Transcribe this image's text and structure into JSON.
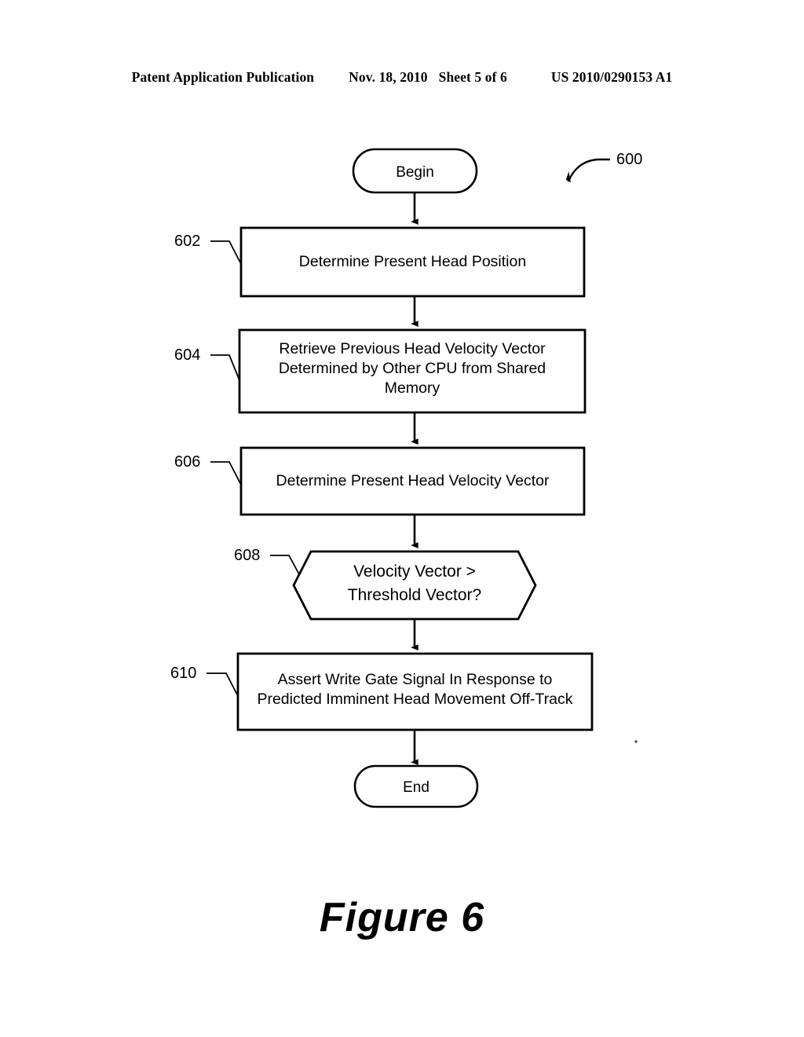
{
  "header": {
    "publication": "Patent Application Publication",
    "date": "Nov. 18, 2010",
    "sheet": "Sheet 5 of 6",
    "patent_number": "US 2010/0290153 A1"
  },
  "figure": {
    "caption": "Figure 6",
    "diagram_reference": "600",
    "nodes": [
      {
        "id": "begin",
        "shape": "terminal",
        "label": "Begin",
        "ref": null
      },
      {
        "id": "step-602",
        "shape": "process",
        "label": "Determine Present Head Position",
        "ref": "602"
      },
      {
        "id": "step-604",
        "shape": "process",
        "label": "Retrieve Previous Head Velocity Vector\nDetermined by Other CPU from Shared\nMemory",
        "ref": "604"
      },
      {
        "id": "step-606",
        "shape": "process",
        "label": "Determine Present Head Velocity Vector",
        "ref": "606"
      },
      {
        "id": "step-608",
        "shape": "decision-hexagon",
        "label": "Velocity Vector >\nThreshold Vector?",
        "ref": "608"
      },
      {
        "id": "step-610",
        "shape": "process",
        "label": "Assert Write Gate Signal In Response to\nPredicted Imminent Head Movement Off-Track",
        "ref": "610"
      },
      {
        "id": "end",
        "shape": "terminal",
        "label": "End",
        "ref": null
      }
    ]
  },
  "colors": {
    "ink": "#000000",
    "paper": "#ffffff"
  }
}
